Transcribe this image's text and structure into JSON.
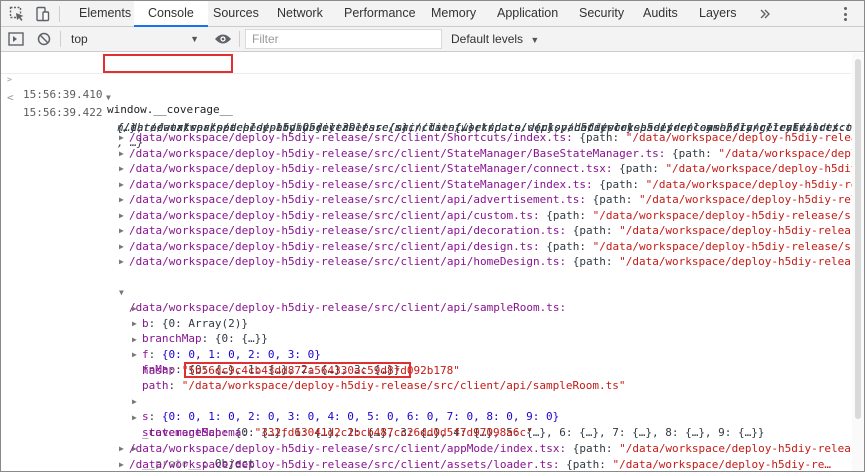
{
  "tabs": [
    "Elements",
    "Console",
    "Sources",
    "Network",
    "Performance",
    "Memory",
    "Application",
    "Security",
    "Audits",
    "Layers"
  ],
  "active_tab": "Console",
  "toolbar": {
    "context": "top",
    "filter_placeholder": "Filter",
    "levels_label": "Default levels"
  },
  "command": {
    "timestamp": "15:56:39.410",
    "text": "window.__coverage__"
  },
  "result": {
    "timestamp": "15:56:39.422",
    "summary_lines": [
      "{/data/workspace/deploy-h5diy-release/src/main.ts: {…}, /data/workspace/deploy-h5diy-release/src/client/index.tsx:",
      "{…}, /data/workspace/deploy-h5diy-release/src/client/setup.ts: {…}, /data/workspace/deploy-h5diy-release/src/commo",
      "n/three-extras/patches/patchObject3D.ts: {…}, /data/workspace/deploy-h5diy-release/src/common/lang/tryEval.ts: {…}",
      ", …}"
    ],
    "entries_before": [
      {
        "key": "/data/workspace/deploy-h5diy-release/src/client/Shortcuts/index.ts:",
        "value": " {path: ",
        "str": "\"/data/workspace/deploy-h5diy-release…"
      },
      {
        "key": "/data/workspace/deploy-h5diy-release/src/client/StateManager/BaseStateManager.ts:",
        "value": " {path: ",
        "str": "\"/data/workspace/deploy…"
      },
      {
        "key": "/data/workspace/deploy-h5diy-release/src/client/StateManager/connect.tsx:",
        "value": " {path: ",
        "str": "\"/data/workspace/deploy-h5diy-relea…"
      },
      {
        "key": "/data/workspace/deploy-h5diy-release/src/client/StateManager/index.ts:",
        "value": " {path: ",
        "str": "\"/data/workspace/deploy-h5diy-re…"
      },
      {
        "key": "/data/workspace/deploy-h5diy-release/src/client/api/advertisement.ts:",
        "value": " {path: ",
        "str": "\"/data/workspace/deploy-h5diy-rel…"
      },
      {
        "key": "/data/workspace/deploy-h5diy-release/src/client/api/custom.ts:",
        "value": " {path: ",
        "str": "\"/data/workspace/deploy-h5diy-release/src/…"
      },
      {
        "key": "/data/workspace/deploy-h5diy-release/src/client/api/decoration.ts:",
        "value": " {path: ",
        "str": "\"/data/workspace/deploy-h5diy-release/…"
      },
      {
        "key": "/data/workspace/deploy-h5diy-release/src/client/api/design.ts:",
        "value": " {path: ",
        "str": "\"/data/workspace/deploy-h5diy-release/src/…"
      },
      {
        "key": "/data/workspace/deploy-h5diy-release/src/client/api/homeDesign.ts:",
        "value": " {path: ",
        "str": "\"/data/workspace/deploy-h5diy-release/…"
      }
    ],
    "expanded_key": "/data/workspace/deploy-h5diy-release/src/client/api/sampleRoom.ts:",
    "expanded_props": {
      "b": "{0: Array(2)}",
      "branchMap": "{0: {…}}",
      "f": "{0: 0, 1: 0, 2: 0, 3: 0}",
      "fnMap": "{0: {…}, 1: {…}, 2: {…}, 3: {…}}",
      "hash": "\"5b56dc9c4cb43dd877a564330ac59d8fd092b178\"",
      "path_prefix": "\"",
      "path_highlight": "/data/workspace/deploy-h5diy-release",
      "path_rest": "/src/client/api/sampleRoom.ts\"",
      "s": "{0: 0, 1: 0, 2: 0, 3: 0, 4: 0, 5: 0, 6: 0, 7: 0, 8: 0, 9: 0}",
      "statementMap": "{0: {…}, 1: {…}, 2: {…}, 3: {…}, 4: {…}, 5: {…}, 6: {…}, 7: {…}, 8: {…}, 9: {…}}",
      "coverageSchema": "\"332fd63041d2c1bcb487cc26dd0d5f7d97098a6c\"",
      "proto": "Object"
    },
    "prop_labels": {
      "b": "b",
      "branchMap": "branchMap",
      "f": "f",
      "fnMap": "fnMap",
      "hash": "hash",
      "path": "path",
      "s": "s",
      "statementMap": "statementMap",
      "coverageSchema": "_coverageSchema",
      "proto": "__proto__"
    },
    "entries_after": [
      {
        "key": "/data/workspace/deploy-h5diy-release/src/client/appMode/index.tsx:",
        "value": " {path: ",
        "str": "\"/data/workspace/deploy-h5diy-release…"
      },
      {
        "key": "/data/workspace/deploy-h5diy-release/src/client/assets/loader.ts:",
        "value": " {path: ",
        "str": "\"/data/workspace/deploy-h5diy-re…"
      }
    ]
  },
  "colors": {
    "accent": "#1a73e8",
    "highlight_box": "#e03030",
    "property_key": "#881391",
    "string": "#c41a16",
    "number": "#1c00cf"
  },
  "icons": [
    "inspect-icon",
    "device-toggle-icon",
    "more-tabs-icon",
    "sidebar-toggle-icon",
    "clear-console-icon",
    "eye-icon",
    "kebab-menu-icon"
  ]
}
